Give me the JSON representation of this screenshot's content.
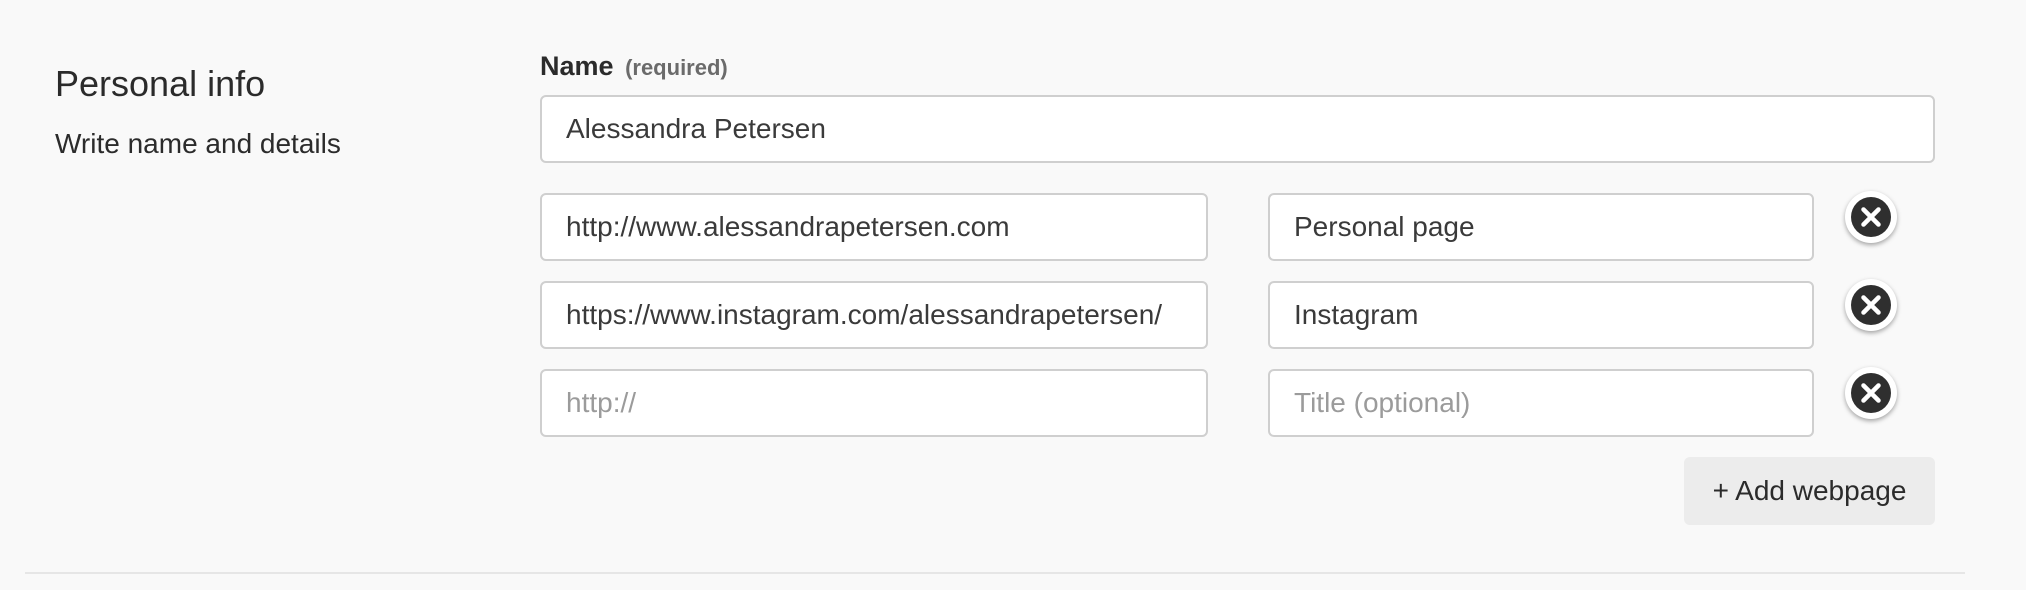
{
  "section": {
    "title": "Personal info",
    "subtitle": "Write name and details"
  },
  "name": {
    "label": "Name",
    "required_label": "(required)",
    "value": "Alessandra Petersen"
  },
  "webpages": [
    {
      "url": "http://www.alessandrapetersen.com",
      "url_placeholder": "http://",
      "title": "Personal page",
      "title_placeholder": "Title (optional)"
    },
    {
      "url": "https://www.instagram.com/alessandrapetersen/",
      "url_placeholder": "http://",
      "title": "Instagram",
      "title_placeholder": "Title (optional)"
    },
    {
      "url": "",
      "url_placeholder": "http://",
      "title": "",
      "title_placeholder": "Title (optional)"
    }
  ],
  "add_webpage_label": "+ Add webpage",
  "icons": {
    "remove": "close-circle-icon"
  },
  "colors": {
    "background": "#f9f9f9",
    "field_border": "#cfcfcf",
    "icon_fill": "#2f2f2f",
    "button_bg": "#ececec"
  }
}
